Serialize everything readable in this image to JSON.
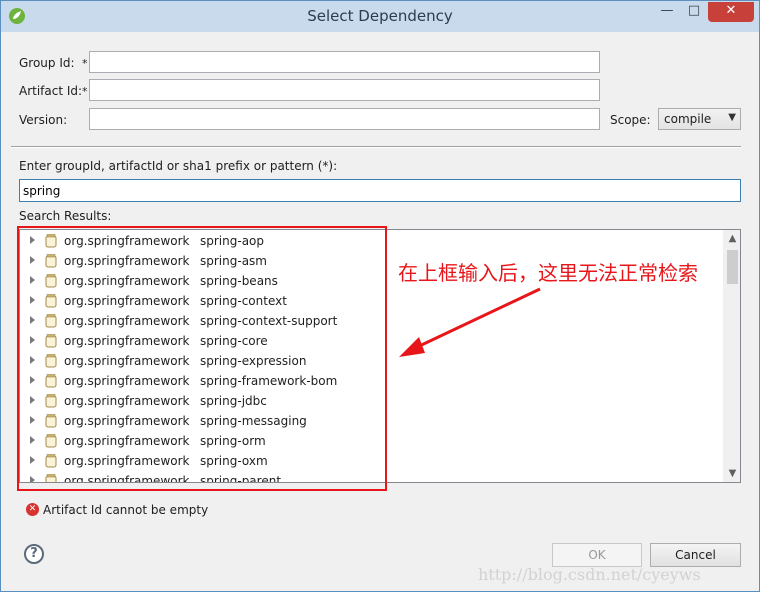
{
  "window": {
    "title": "Select Dependency",
    "minimize_glyph": "—",
    "maximize_glyph": "□",
    "close_glyph": "✕"
  },
  "form": {
    "group_id_label": "Group Id:",
    "group_id_value": "",
    "artifact_id_label": "Artifact Id:",
    "artifact_id_value": "",
    "required_marker": "*",
    "version_label": "Version:",
    "version_value": "",
    "scope_label": "Scope:",
    "scope_value": "compile"
  },
  "search": {
    "prompt_label": "Enter groupId, artifactId or sha1 prefix or pattern (*):",
    "query": "spring",
    "results_label": "Search Results:"
  },
  "results": [
    {
      "group": "org.springframework",
      "artifact": "spring-aop"
    },
    {
      "group": "org.springframework",
      "artifact": "spring-asm"
    },
    {
      "group": "org.springframework",
      "artifact": "spring-beans"
    },
    {
      "group": "org.springframework",
      "artifact": "spring-context"
    },
    {
      "group": "org.springframework",
      "artifact": "spring-context-support"
    },
    {
      "group": "org.springframework",
      "artifact": "spring-core"
    },
    {
      "group": "org.springframework",
      "artifact": "spring-expression"
    },
    {
      "group": "org.springframework",
      "artifact": "spring-framework-bom"
    },
    {
      "group": "org.springframework",
      "artifact": "spring-jdbc"
    },
    {
      "group": "org.springframework",
      "artifact": "spring-messaging"
    },
    {
      "group": "org.springframework",
      "artifact": "spring-orm"
    },
    {
      "group": "org.springframework",
      "artifact": "spring-oxm"
    },
    {
      "group": "org.springframework",
      "artifact": "spring-parent"
    }
  ],
  "annotation": {
    "text": "在上框输入后，这里无法正常检索",
    "color": "#e8161a"
  },
  "status": {
    "error_message": "Artifact Id cannot be empty",
    "error_icon": "error-icon"
  },
  "buttons": {
    "help": "?",
    "ok": "OK",
    "cancel": "Cancel"
  },
  "watermark": "http://blog.csdn.net/cyeyws"
}
